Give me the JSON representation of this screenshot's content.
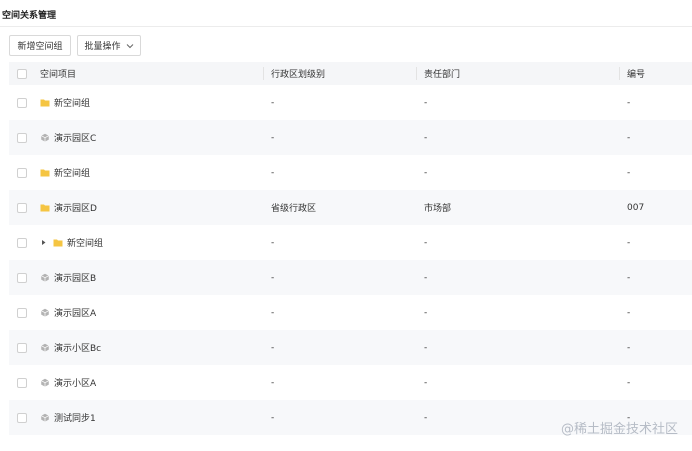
{
  "page_title": "空间关系管理",
  "toolbar": {
    "new_group_label": "新增空间组",
    "batch_ops_label": "批量操作"
  },
  "table": {
    "headers": {
      "name": "空间项目",
      "level": "行政区划级别",
      "dept": "责任部门",
      "code": "编号"
    },
    "rows": [
      {
        "name": "新空间组",
        "icon": "folder-icon",
        "expandable": false,
        "level": "-",
        "dept": "-",
        "code": "-"
      },
      {
        "name": "演示园区C",
        "icon": "cube-icon",
        "expandable": false,
        "level": "-",
        "dept": "-",
        "code": "-"
      },
      {
        "name": "新空间组",
        "icon": "folder-icon",
        "expandable": false,
        "level": "-",
        "dept": "-",
        "code": "-"
      },
      {
        "name": "演示园区D",
        "icon": "folder-icon",
        "expandable": false,
        "level": "省级行政区",
        "dept": "市场部",
        "code": "007"
      },
      {
        "name": "新空间组",
        "icon": "folder-icon",
        "expandable": true,
        "level": "-",
        "dept": "-",
        "code": "-"
      },
      {
        "name": "演示园区B",
        "icon": "cube-icon",
        "expandable": false,
        "level": "-",
        "dept": "-",
        "code": "-"
      },
      {
        "name": "演示园区A",
        "icon": "cube-icon",
        "expandable": false,
        "level": "-",
        "dept": "-",
        "code": "-"
      },
      {
        "name": "演示小区Bc",
        "icon": "cube-icon",
        "expandable": false,
        "level": "-",
        "dept": "-",
        "code": "-"
      },
      {
        "name": "演示小区A",
        "icon": "cube-icon",
        "expandable": false,
        "level": "-",
        "dept": "-",
        "code": "-"
      },
      {
        "name": "测试同步1",
        "icon": "cube-icon",
        "expandable": false,
        "level": "-",
        "dept": "-",
        "code": "-"
      }
    ]
  },
  "colors": {
    "folder": "#f5c542",
    "cube": "#b3b3b3",
    "header_bg": "#f5f6f8",
    "stripe_bg": "#f7f8fa"
  },
  "watermark": "@稀土掘金技术社区"
}
